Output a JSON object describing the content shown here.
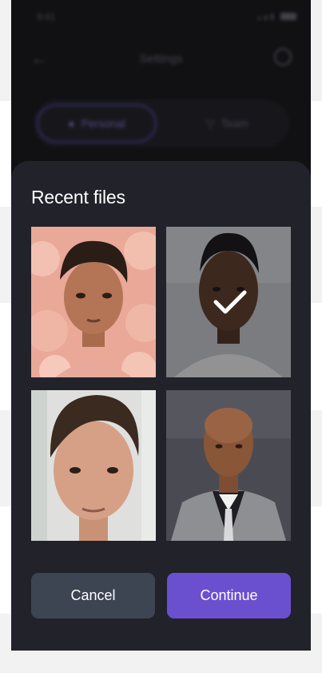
{
  "status_bar": {
    "time": "9:41"
  },
  "header": {
    "title": "Settings"
  },
  "segments": [
    {
      "label": "Personal"
    },
    {
      "label": "Team"
    }
  ],
  "sheet": {
    "title": "Recent files",
    "files": [
      {
        "name": "photo-1",
        "selected": false
      },
      {
        "name": "photo-2",
        "selected": true
      },
      {
        "name": "photo-3",
        "selected": false
      },
      {
        "name": "photo-4",
        "selected": false
      }
    ],
    "cancel_label": "Cancel",
    "continue_label": "Continue"
  },
  "colors": {
    "sheet_bg": "#21222a",
    "cancel_bg": "#3d4452",
    "continue_bg": "#6a4fcf",
    "accent": "#5a45b5"
  }
}
